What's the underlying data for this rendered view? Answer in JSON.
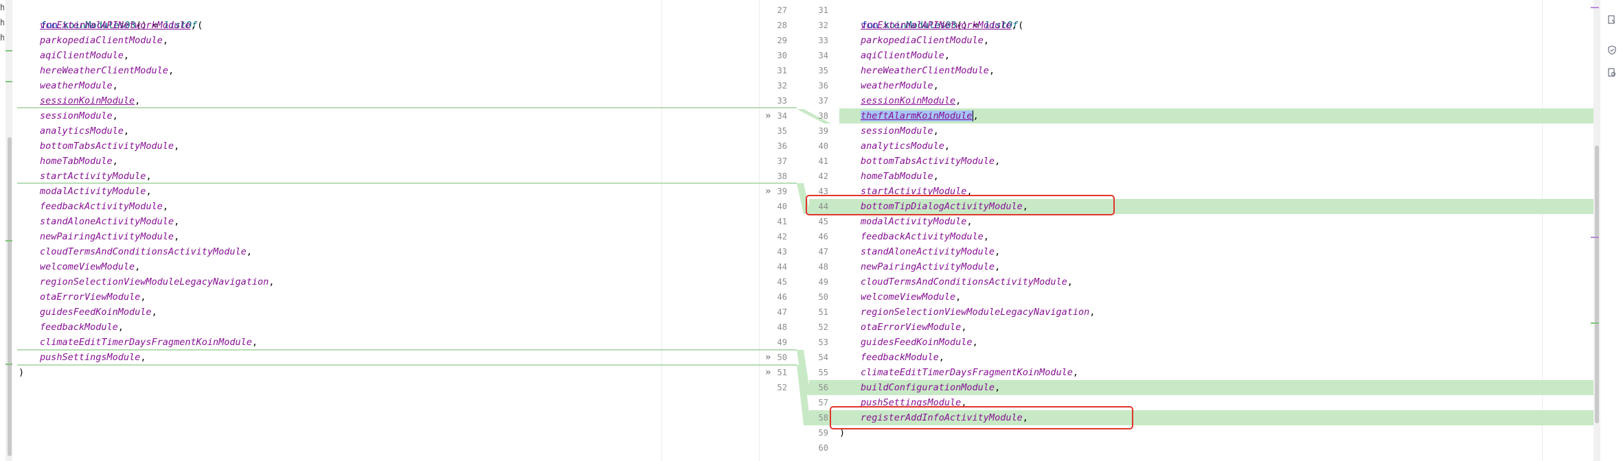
{
  "left": {
    "header": {
      "kw": "fun",
      "name": "koinModules03",
      "sig": "() = ",
      "call": "listOf",
      "paren": "("
    },
    "items": [
      {
        "name": "vccExternalAPINetworkModule",
        "underline": true
      },
      {
        "name": "parkopediaClientModule"
      },
      {
        "name": "aqiClientModule"
      },
      {
        "name": "hereWeatherClientModule"
      },
      {
        "name": "weatherModule"
      },
      {
        "name": "sessionKoinModule",
        "underline": true
      },
      {
        "name": "sessionModule"
      },
      {
        "name": "analyticsModule"
      },
      {
        "name": "bottomTabsActivityModule"
      },
      {
        "name": "homeTabModule"
      },
      {
        "name": "startActivityModule"
      },
      {
        "name": "modalActivityModule"
      },
      {
        "name": "feedbackActivityModule"
      },
      {
        "name": "standAloneActivityModule"
      },
      {
        "name": "newPairingActivityModule"
      },
      {
        "name": "cloudTermsAndConditionsActivityModule"
      },
      {
        "name": "welcomeViewModule"
      },
      {
        "name": "regionSelectionViewModuleLegacyNavigation"
      },
      {
        "name": "otaErrorViewModule"
      },
      {
        "name": "guidesFeedKoinModule"
      },
      {
        "name": "feedbackModule"
      },
      {
        "name": "climateEditTimerDaysFragmentKoinModule"
      },
      {
        "name": "pushSettingsModule"
      }
    ],
    "close": ")",
    "line_numbers": [
      "27",
      "28",
      "29",
      "30",
      "31",
      "32",
      "33",
      "34",
      "35",
      "36",
      "37",
      "38",
      "39",
      "40",
      "41",
      "42",
      "43",
      "44",
      "45",
      "46",
      "47",
      "48",
      "49",
      "50",
      "51",
      "52"
    ]
  },
  "right": {
    "header": {
      "kw": "fun",
      "name": "koinModules03",
      "sig": "() = ",
      "call": "listOf",
      "paren": "("
    },
    "items": [
      {
        "name": "vccExternalAPINetworkModule",
        "underline": true
      },
      {
        "name": "parkopediaClientModule"
      },
      {
        "name": "aqiClientModule"
      },
      {
        "name": "hereWeatherClientModule"
      },
      {
        "name": "weatherModule"
      },
      {
        "name": "sessionKoinModule",
        "underline": true
      },
      {
        "name": "theftAlarmKoinModule",
        "underline": true,
        "added": true,
        "selected": true
      },
      {
        "name": "sessionModule"
      },
      {
        "name": "analyticsModule"
      },
      {
        "name": "bottomTabsActivityModule"
      },
      {
        "name": "homeTabModule"
      },
      {
        "name": "startActivityModule"
      },
      {
        "name": "bottomTipDialogActivityModule",
        "added": true
      },
      {
        "name": "modalActivityModule"
      },
      {
        "name": "feedbackActivityModule"
      },
      {
        "name": "standAloneActivityModule"
      },
      {
        "name": "newPairingActivityModule"
      },
      {
        "name": "cloudTermsAndConditionsActivityModule"
      },
      {
        "name": "welcomeViewModule"
      },
      {
        "name": "regionSelectionViewModuleLegacyNavigation"
      },
      {
        "name": "otaErrorViewModule"
      },
      {
        "name": "guidesFeedKoinModule"
      },
      {
        "name": "feedbackModule"
      },
      {
        "name": "climateEditTimerDaysFragmentKoinModule"
      },
      {
        "name": "buildConfigurationModule",
        "added": true
      },
      {
        "name": "pushSettingsModule"
      },
      {
        "name": "registerAddInfoActivityModule",
        "added": true
      }
    ],
    "close": ")",
    "line_numbers": [
      "31",
      "32",
      "33",
      "34",
      "35",
      "36",
      "37",
      "38",
      "39",
      "40",
      "41",
      "42",
      "43",
      "44",
      "45",
      "46",
      "47",
      "48",
      "49",
      "50",
      "51",
      "52",
      "53",
      "54",
      "55",
      "56",
      "57",
      "58",
      "59",
      "60"
    ]
  },
  "gutter_arrow": "»",
  "colors": {
    "added": "#c8e9c6",
    "highlight": "#e0342a",
    "keyword": "#0033b3",
    "module": "#871094"
  },
  "icons": [
    "structure-icon",
    "shield-icon",
    "inspect-icon"
  ]
}
